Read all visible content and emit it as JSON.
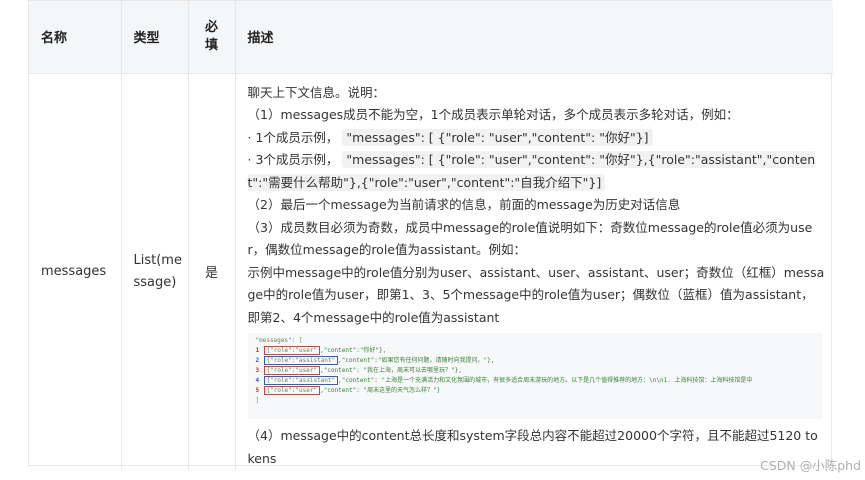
{
  "table": {
    "headers": {
      "name": "名称",
      "type": "类型",
      "required_line1": "必",
      "required_line2": "填",
      "description": "描述"
    },
    "row": {
      "name": "messages",
      "type_line1": "List(me",
      "type_line2": "ssage)",
      "required": "是",
      "description_lines": [
        "聊天上下文信息。说明：",
        "（1）messages成员不能为空，1个成员表示单轮对话，多个成员表示多轮对话，例如：",
        "（2）最后一个message为当前请求的信息，前面的message为历史对话信息",
        "（3）成员数目必须为奇数，成员中message的role值说明如下：奇数位message的role值必须为user，偶数位message的role值为assistant。例如：",
        "示例中message中的role值分别为user、assistant、user、assistant、user；奇数位（红框）message中的role值为user，即第1、3、5个message中的role值为user；偶数位（蓝框）值为assistant，即第2、4个message中的role值为assistant",
        "（4）message中的content总长度和system字段总内容不能超过20000个字符，且不能超过5120 tokens"
      ],
      "example_one_prefix": "· 1个成员示例，",
      "example_one_code": "\"messages\": [ {\"role\": \"user\",\"content\": \"你好\"}]",
      "example_three_prefix": "· 3个成员示例，",
      "example_three_code": "\"messages\": [ {\"role\": \"user\",\"content\": \"你好\"},{\"role\":\"assistant\",\"content\":\"需要什么帮助\"},{\"role\":\"user\",\"content\":\"自我介绍下\"}]"
    }
  },
  "code_image": {
    "open": "\"messages\": [",
    "close": "]",
    "rows": [
      {
        "num": "1",
        "box": "{\"role\":\"user\"",
        "rest": ",\"content\":\"你好\"},",
        "color": "red"
      },
      {
        "num": "2",
        "box": "{\"role\":\"assistant\"",
        "rest": ",\"content\":\"如果您有任何问题，请随时向我提问。\"},",
        "color": "blue"
      },
      {
        "num": "3",
        "box": "{\"role\":\"user\"",
        "rest": ",\"content\": \"我在上海，周末可以去哪里玩？\"},",
        "color": "red"
      },
      {
        "num": "4",
        "box": "{\"role\":\"assistant\"",
        "rest": ",\"content\": \"上海是一个充满活力和文化氛围的城市，有很多适合周末游玩的地方。以下是几个值得推荐的地方：\\n\\n1. 上海科技馆：上海科技馆是中",
        "color": "blue"
      },
      {
        "num": "5",
        "box": "{\"role\":\"user\"",
        "rest": ",\"content\": \"周末这里的天气怎么样？\"}",
        "color": "red"
      }
    ]
  },
  "watermark": "CSDN @小陈phd"
}
